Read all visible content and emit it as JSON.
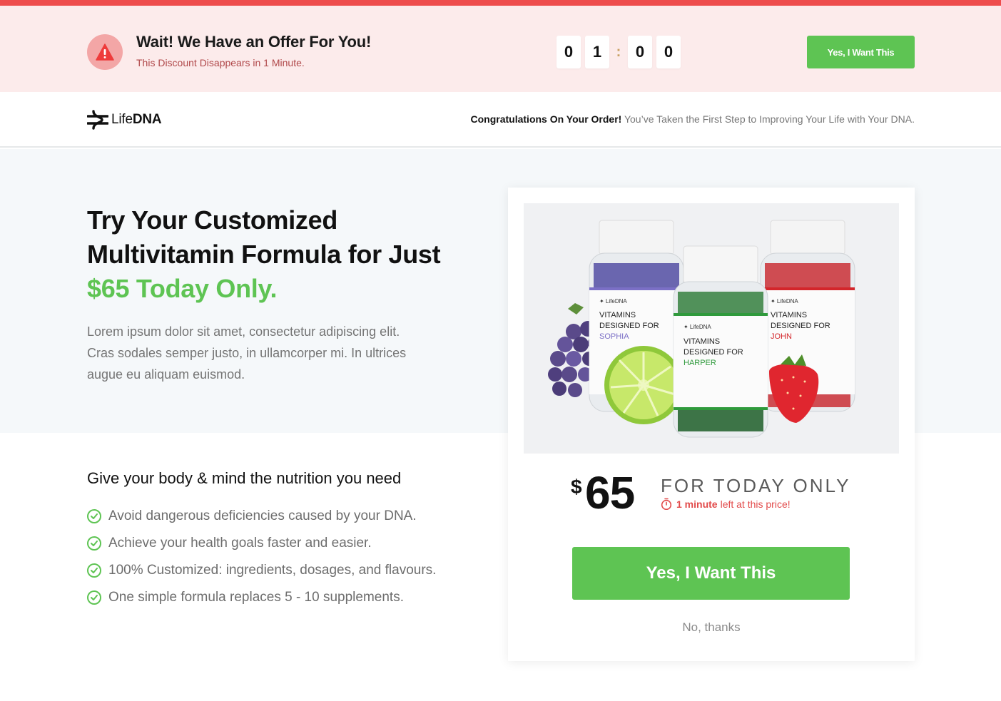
{
  "alert": {
    "icon": "warning-icon",
    "title": "Wait! We Have an Offer For You!",
    "subtitle": "This Discount Disappears in 1 Minute.",
    "timer": {
      "d1": "0",
      "d2": "1",
      "sep": ":",
      "d3": "0",
      "d4": "0"
    },
    "cta_label": "Yes, I Want This"
  },
  "header": {
    "logo_light": "Life",
    "logo_bold": "DNA",
    "congrats_bold": "Congratulations On Your Order!",
    "congrats_text": "You’ve Taken the First Step to Improving Your Life with Your DNA."
  },
  "hero": {
    "headline_main": "Try Your Customized Multivitamin Formula for Just ",
    "headline_accent": "$65 Today Only.",
    "body": "Lorem ipsum dolor sit amet, consectetur adipiscing elit. Cras sodales semper justo, in ullamcorper mi. In ultrices augue eu aliquam euismod."
  },
  "benefits": {
    "title": "Give your body & mind the nutrition you need",
    "items": [
      "Avoid dangerous deficiencies caused by your DNA.",
      "Achieve your health goals faster and easier.",
      "100% Customized: ingredients, dosages, and flavours.",
      "One simple formula replaces 5 - 10 supplements."
    ]
  },
  "offer": {
    "bottles": [
      {
        "brand": "LifeDNA",
        "line1": "VITAMINS",
        "line2": "DESIGNED FOR",
        "name": "SOPHIA",
        "color": "#7b6fc6"
      },
      {
        "brand": "LifeDNA",
        "line1": "VITAMINS",
        "line2": "DESIGNED FOR",
        "name": "HARPER",
        "color": "#2f9a3c"
      },
      {
        "brand": "LifeDNA",
        "line1": "VITAMINS",
        "line2": "DESIGNED FOR",
        "name": "JOHN",
        "color": "#d3262b"
      }
    ],
    "currency": "$",
    "price": "65",
    "today_label": "FOR TODAY ONLY",
    "time_bold": "1 minute",
    "time_rest": "left at this price!",
    "cta_label": "Yes, I Want This",
    "decline_label": "No, thanks"
  },
  "colors": {
    "accent_green": "#5ec453",
    "alert_red": "#ee4c4c",
    "alert_bg": "#fcebeb",
    "hero_bg": "#f5f8fa"
  }
}
